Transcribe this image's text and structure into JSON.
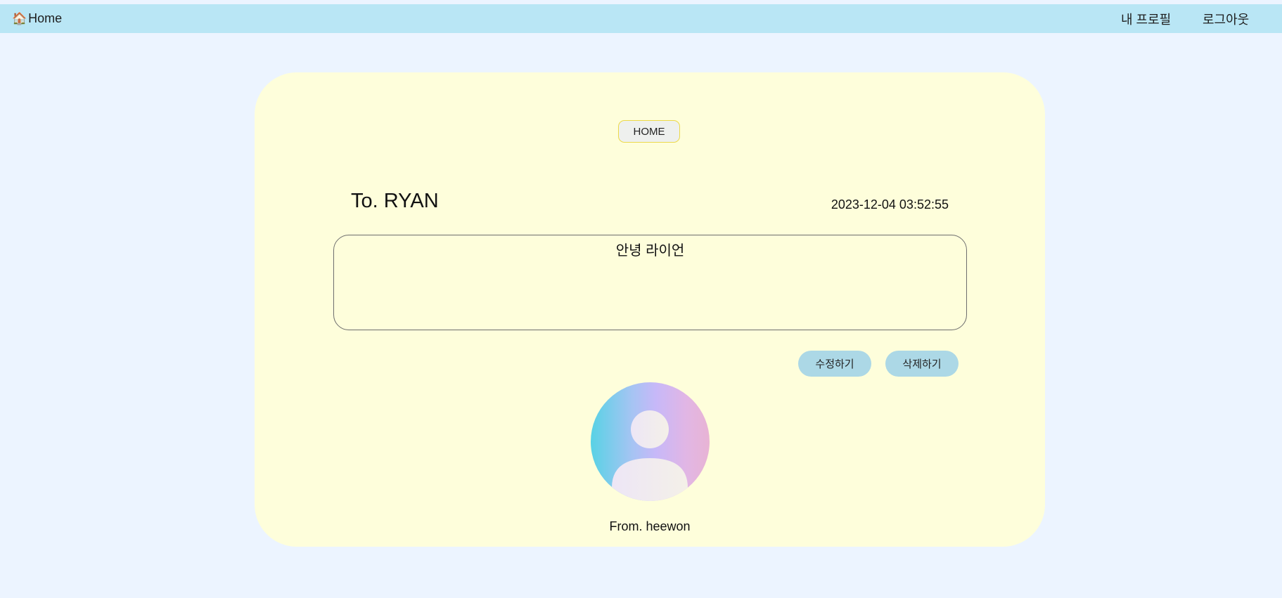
{
  "nav": {
    "home_icon": "house-icon",
    "home_glyph": "🏠",
    "home_label": "Home",
    "profile_label": "내 프로필",
    "logout_label": "로그아웃"
  },
  "letter": {
    "home_button_label": "HOME",
    "to_text": "To. RYAN",
    "date": "2023-12-04 03:52:55",
    "message": "안녕 라이언",
    "edit_label": "수정하기",
    "delete_label": "삭제하기",
    "avatar_icon": "user-avatar-icon",
    "from_text": "From. heewon"
  },
  "colors": {
    "page_bg": "#ecf4ff",
    "topbar_bg": "#b9e6f5",
    "card_bg": "#fefedb",
    "button_bg": "#acd8e6",
    "home_button_border": "#ecd94a"
  }
}
